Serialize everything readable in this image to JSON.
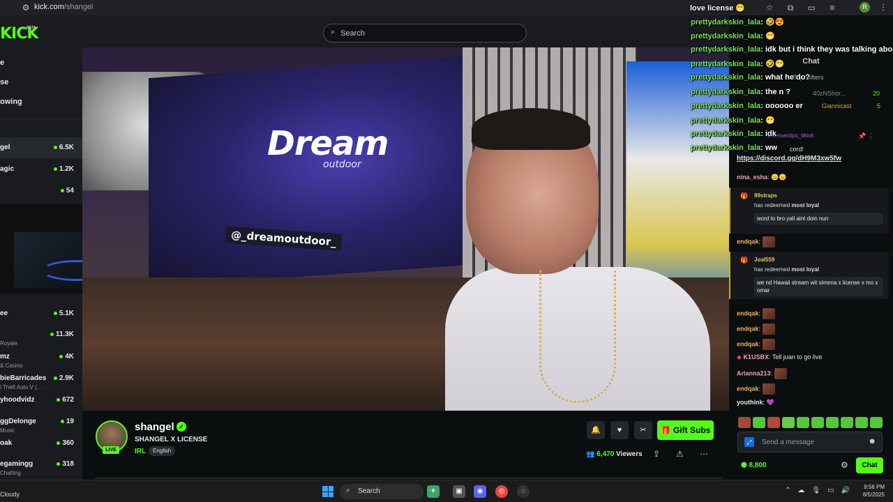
{
  "browser": {
    "url_host": "kick.com",
    "url_path": "/shangel",
    "extension_icons": [
      "star-icon",
      "puzzle-icon",
      "tab-icon",
      "media-icon"
    ],
    "profile_initial": "R"
  },
  "header": {
    "logo": "KICK",
    "logo_badge": "BETA",
    "search_placeholder": "Search"
  },
  "sidebar": {
    "nav": [
      {
        "label": "e"
      },
      {
        "label": "se"
      },
      {
        "label": "owing"
      }
    ],
    "channels_top": [
      {
        "name": "gel",
        "sub": "",
        "count": "6.5K"
      },
      {
        "name": "agic",
        "sub": "",
        "count": "1.2K"
      },
      {
        "name": "",
        "sub": "",
        "count": "54"
      }
    ],
    "channels_bottom": [
      {
        "name": "ee",
        "sub": "",
        "count": "5.1K"
      },
      {
        "name": "",
        "sub": "Royale",
        "count": "11.3K"
      },
      {
        "name": "mz",
        "sub": "& Casino",
        "count": "4K"
      },
      {
        "name": "bieBarricades",
        "sub": "l Theft Auto V (...",
        "count": "2.9K"
      },
      {
        "name": "yhoodvidz",
        "sub": "",
        "count": "672"
      },
      {
        "name": "ggDelonge",
        "sub": "Music",
        "count": "19"
      },
      {
        "name": "oak",
        "sub": "",
        "count": "360"
      },
      {
        "name": "egamingg",
        "sub": "Chatting",
        "count": "318"
      }
    ]
  },
  "video": {
    "billboard_text": "Dream",
    "billboard_sub": "outdoor",
    "billboard_handle": "@_dreamoutdoor_"
  },
  "stream": {
    "streamer": "shangel",
    "live_label": "LIVE",
    "title": "SHANGEL X LICENSE",
    "category": "IRL",
    "language": "English",
    "gift_label": "Gift Subs",
    "viewers": "6,470",
    "viewers_label": "Viewers"
  },
  "overlay_chat": {
    "first_line": "love license",
    "lines": [
      {
        "user": "prettydarkskin_lala",
        "text": ": 🤣😍"
      },
      {
        "user": "prettydarkskin_lala",
        "text": ": 😁"
      },
      {
        "user": "prettydarkskin_lala",
        "text": ": idk but i think they was talking about"
      },
      {
        "user": "prettydarkskin_lala",
        "text": ": 🤣😁"
      },
      {
        "user": "prettydarkskin_lala",
        "text": ": what he do?"
      },
      {
        "user": "prettydarkskin_lala",
        "text": ": the n ?"
      },
      {
        "user": "prettydarkskin_lala",
        "text": ": oooooo er"
      },
      {
        "user": "prettydarkskin_lala",
        "text": ": 😁"
      },
      {
        "user": "prettydarkskin_lala",
        "text": ": idk"
      },
      {
        "user": "prettydarkskin_lala",
        "text": ": ww"
      }
    ]
  },
  "chat": {
    "header": "Chat",
    "gifters_label": "Top Gifters",
    "gifters": [
      {
        "name": "40zNShor...",
        "count": "20"
      },
      {
        "name": "Giannicast",
        "count": "5"
      }
    ],
    "pinned_user": "Licenseclips_tiktok",
    "discord_fragment": "cord!",
    "discord_link": "https://discord.gg/dH9M3xw5fw",
    "messages": [
      {
        "user": "nina_esha",
        "text": ": 😑😑",
        "color": "#e8a0b8"
      },
      {
        "user": "endqak",
        "text": ":",
        "color": "#f0b060"
      },
      {
        "user": "endqak",
        "text": ":",
        "color": "#f0b060"
      },
      {
        "user": "endqak",
        "text": ":",
        "color": "#f0b060"
      },
      {
        "user": "endqak",
        "text": ":",
        "color": "#f0b060"
      },
      {
        "user": "K1USBX",
        "text": ": Tell juan to go live",
        "color": "#e8a0b8"
      },
      {
        "user": "Arianna213",
        "text": ":",
        "color": "#e8a0b8"
      },
      {
        "user": "endqak",
        "text": ":",
        "color": "#f0b060"
      },
      {
        "user": "youthink",
        "text": ": 💜",
        "color": "#e5e5e5"
      }
    ],
    "redeems": [
      {
        "user": "99straps",
        "verb": "has redeemed",
        "reward": "most loyal",
        "message": "word to bro yall aint doin nun"
      },
      {
        "user": "Joal559",
        "verb": "has redeemed",
        "reward": "most loyal",
        "message": "we nd Hawaii stream wit ximena x license x mo x omar"
      }
    ],
    "input_placeholder": "Send a message",
    "points": "8,800",
    "chat_button": "Chat"
  },
  "taskbar": {
    "weather": "Cloudy",
    "search_label": "Search",
    "time": "9:56 PM",
    "date": "8/5/2025"
  }
}
